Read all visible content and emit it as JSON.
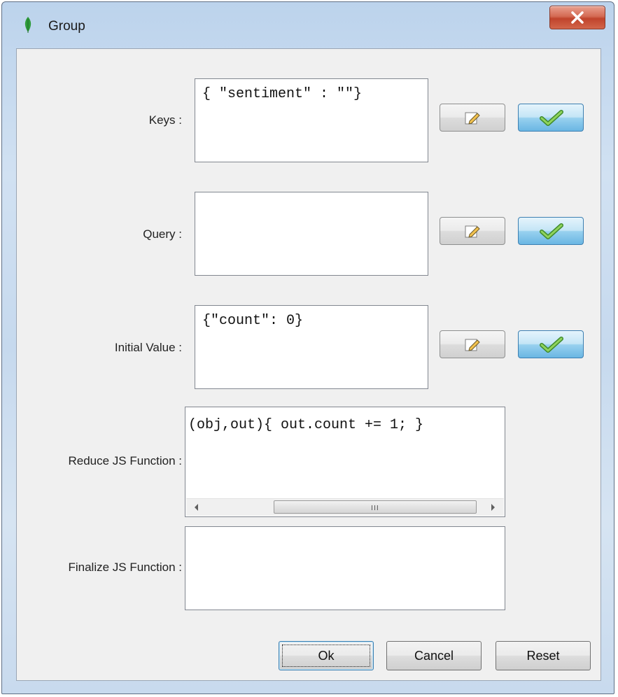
{
  "window": {
    "title": "Group",
    "icon": "mongodb-leaf-icon",
    "close_icon": "close-x-icon"
  },
  "fields": {
    "keys": {
      "label": "Keys :",
      "value": "{ \"sentiment\" : \"\"}"
    },
    "query": {
      "label": "Query :",
      "value": ""
    },
    "initial_value": {
      "label": "Initial Value :",
      "value": "{\"count\": 0}"
    },
    "reduce": {
      "label": "Reduce JS Function :",
      "value": "(obj,out){ out.count += 1; }",
      "scroll_grip": "III"
    },
    "finalize": {
      "label": "Finalize JS Function :",
      "value": ""
    }
  },
  "buttons": {
    "ok": "Ok",
    "cancel": "Cancel",
    "reset": "Reset"
  },
  "colors": {
    "apply_button": "#98d1ef",
    "close_button": "#c0442c",
    "leaf_icon": "#2e9b3a"
  }
}
